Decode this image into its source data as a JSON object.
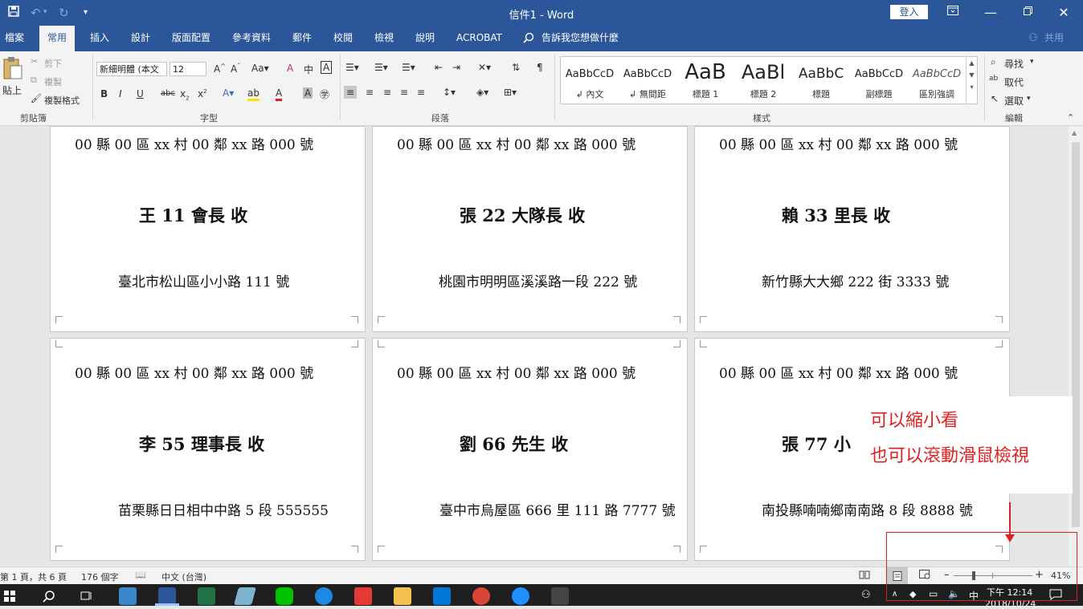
{
  "window": {
    "title": "信件1  -  Word",
    "login_label": "登入"
  },
  "tabs": [
    {
      "label": "檔案"
    },
    {
      "label": "常用"
    },
    {
      "label": "插入"
    },
    {
      "label": "設計"
    },
    {
      "label": "版面配置"
    },
    {
      "label": "參考資料"
    },
    {
      "label": "郵件"
    },
    {
      "label": "校閱"
    },
    {
      "label": "檢視"
    },
    {
      "label": "說明"
    },
    {
      "label": "ACROBAT"
    }
  ],
  "tell_me": "告訴我您想做什麼",
  "share_label": "共用",
  "ribbon": {
    "clipboard": {
      "label": "剪貼簿",
      "paste": "貼上",
      "cut": "剪下",
      "copy": "複製",
      "format_painter": "複製格式"
    },
    "font": {
      "label": "字型",
      "font_name": "新細明體 (本文",
      "font_size": "12"
    },
    "paragraph": {
      "label": "段落"
    },
    "styles": {
      "label": "樣式",
      "items": [
        {
          "preview": "AaBbCcD",
          "name": "↲ 內文"
        },
        {
          "preview": "AaBbCcD",
          "name": "↲ 無間距"
        },
        {
          "preview": "AaB",
          "name": "標題 1"
        },
        {
          "preview": "AaBl",
          "name": "標題 2"
        },
        {
          "preview": "AaBbC",
          "name": "標題"
        },
        {
          "preview": "AaBbCcD",
          "name": "副標題"
        },
        {
          "preview": "AaBbCcD",
          "name": "區別強調"
        }
      ]
    },
    "editing": {
      "label": "編輯",
      "find": "尋找",
      "replace": "取代",
      "select": "選取"
    }
  },
  "envelopes": [
    {
      "sender": "00 縣 00 區 xx 村 00 鄰 xx 路 000 號",
      "recipient": "王 11  會長  收",
      "address": "臺北市松山區小小路 111 號"
    },
    {
      "sender": "00 縣 00 區 xx 村 00 鄰 xx 路 000 號",
      "recipient": "張 22  大隊長  收",
      "address": "桃園市明明區溪溪路一段 222 號"
    },
    {
      "sender": "00 縣 00 區 xx 村 00 鄰 xx 路 000 號",
      "recipient": "賴 33  里長  收",
      "address": "新竹縣大大鄉 222 街 3333 號"
    },
    {
      "sender": "00 縣 00 區 xx 村 00 鄰 xx 路 000 號",
      "recipient": "李 55  理事長  收",
      "address": "苗栗縣日日相中中路 5 段 555555"
    },
    {
      "sender": "00 縣 00 區 xx 村 00 鄰 xx 路 000 號",
      "recipient": "劉 66  先生  收",
      "address": "臺中市烏屋區 666 里 111 路 7777 號"
    },
    {
      "sender": "00 縣 00 區 xx 村 00 鄰 xx 路 000 號",
      "recipient": "張 77  小",
      "address": "南投縣喃喃鄉南南路 8 段 8888 號"
    }
  ],
  "annotation": {
    "line1": "可以縮小看",
    "line2": "也可以滾動滑鼠檢視"
  },
  "status": {
    "page": "第 1 頁，共 6 頁",
    "words": "176 個字",
    "language": "中文 (台灣)",
    "zoom": "41%",
    "zoom_fraction": 0.25
  },
  "taskbar": {
    "time": "下午 12:14",
    "date": "2018/10/24",
    "ime": "中"
  }
}
